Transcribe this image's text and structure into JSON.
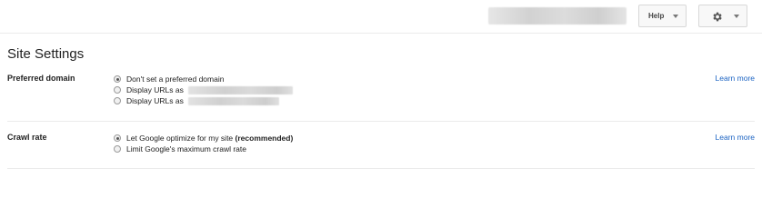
{
  "header": {
    "help_label": "Help",
    "settings_icon": "gear-icon"
  },
  "page": {
    "title": "Site Settings"
  },
  "preferred_domain": {
    "label": "Preferred domain",
    "options": [
      {
        "label": "Don't set a preferred domain",
        "checked": true
      },
      {
        "label": "Display URLs as",
        "checked": false
      },
      {
        "label": "Display URLs as",
        "checked": false
      }
    ],
    "learn_more": "Learn more"
  },
  "crawl_rate": {
    "label": "Crawl rate",
    "options": [
      {
        "label": "Let Google optimize for my site",
        "suffix": "(recommended)",
        "checked": true
      },
      {
        "label": "Limit Google's maximum crawl rate",
        "checked": false
      }
    ],
    "learn_more": "Learn more"
  },
  "colors": {
    "link": "#1a62c2",
    "divider": "#ebebeb"
  }
}
